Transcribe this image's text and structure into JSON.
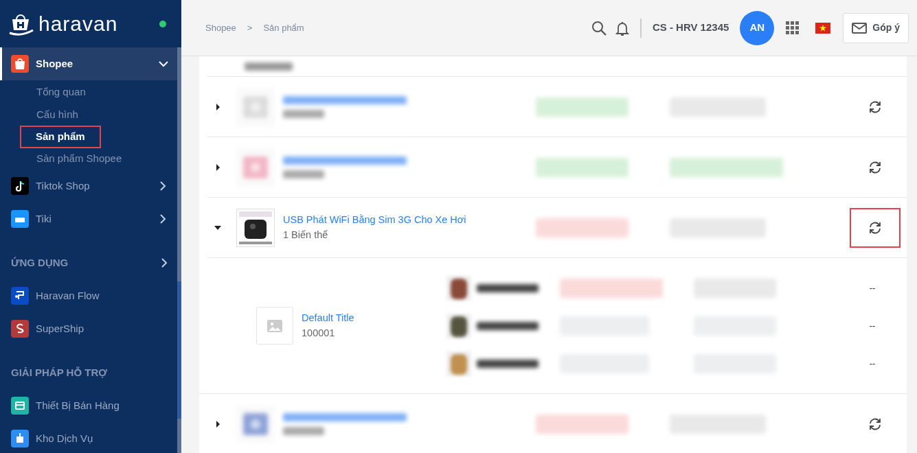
{
  "sidebar": {
    "logo": "haravan",
    "online": true,
    "items": [
      {
        "kind": "app",
        "label": "Shopee",
        "expanded": true,
        "selected": true,
        "children": [
          {
            "label": "Tổng quan",
            "selected": false,
            "highlighted": false
          },
          {
            "label": "Cấu hình",
            "selected": false,
            "highlighted": false
          },
          {
            "label": "Sản phẩm",
            "selected": true,
            "highlighted": true
          },
          {
            "label": "Sản phẩm Shopee",
            "selected": false,
            "highlighted": false
          }
        ]
      },
      {
        "kind": "app",
        "label": "Tiktok Shop",
        "expanded": false,
        "selected": false
      },
      {
        "kind": "app",
        "label": "Tiki",
        "expanded": false,
        "selected": false
      },
      {
        "kind": "section",
        "label": "ỨNG DỤNG",
        "expanded": false
      },
      {
        "kind": "app",
        "label": "Haravan Flow",
        "selected": false
      },
      {
        "kind": "app",
        "label": "SuperShip",
        "selected": false
      },
      {
        "kind": "section",
        "label": "GIẢI PHÁP HỖ TRỢ"
      },
      {
        "kind": "app",
        "label": "Thiết Bị Bán Hàng",
        "selected": false
      },
      {
        "kind": "app",
        "label": "Kho Dịch Vụ",
        "selected": false
      }
    ]
  },
  "breadcrumb": {
    "items": [
      "Shopee",
      "Sản phẩm"
    ],
    "separator": ">"
  },
  "header": {
    "account": "CS - HRV 12345",
    "avatar": "AN",
    "feedback": "Góp ý"
  },
  "rows": [
    {
      "kind": "partial"
    },
    {
      "kind": "blurred",
      "expanded": false,
      "badges": [
        {
          "color": "#d7f0d9"
        },
        {
          "color": "#e9e9e9"
        }
      ],
      "highlighted": false
    },
    {
      "kind": "blurred",
      "expanded": false,
      "badges": [
        {
          "color": "#d7f0d9"
        },
        {
          "color": "#d7f0d9"
        }
      ],
      "highlighted": false
    },
    {
      "kind": "product",
      "expanded": true,
      "title": "USB Phát WiFi Bằng Sim 3G Cho Xe Hơi",
      "variants": "1 Biến thể",
      "badges": [
        {
          "color": "#fbdada"
        },
        {
          "color": "#e9e9e9"
        }
      ],
      "highlighted": true,
      "variant": {
        "title": "Default Title",
        "sku": "100001",
        "channels": [
          {
            "badges": [
              {
                "color": "#fbdada"
              },
              {
                "color": "#e9e9e9"
              }
            ],
            "sync": "--"
          },
          {
            "badges": [
              {
                "color": "#eceef0"
              },
              {
                "color": "#eceef0"
              }
            ],
            "sync": "--"
          },
          {
            "badges": [
              {
                "color": "#eceef0"
              },
              {
                "color": "#eceef0"
              }
            ],
            "sync": "--"
          }
        ]
      }
    },
    {
      "kind": "blurred",
      "expanded": false,
      "badges": [
        {
          "color": "#fbdada"
        },
        {
          "color": "#e9e9e9"
        }
      ],
      "highlighted": false
    }
  ]
}
